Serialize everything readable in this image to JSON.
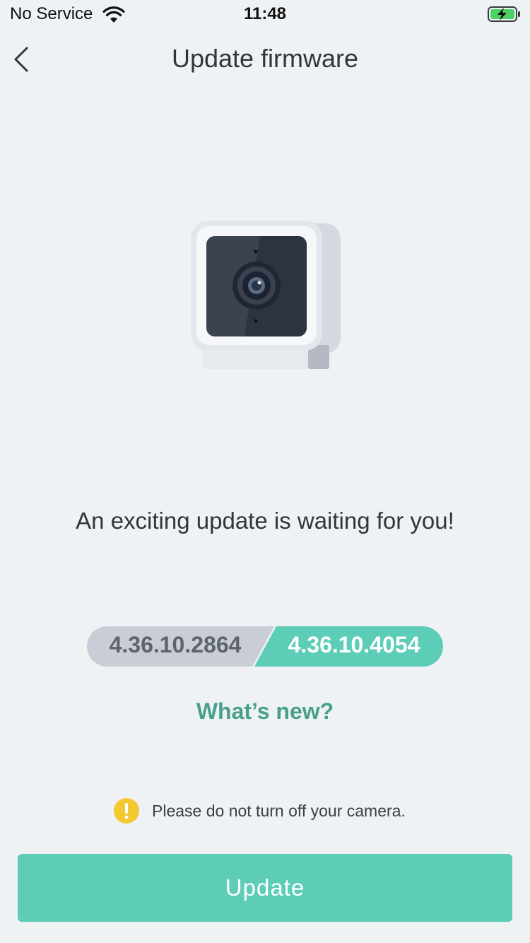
{
  "status_bar": {
    "carrier": "No Service",
    "time": "11:48",
    "wifi_icon": "wifi-icon",
    "battery_icon": "battery-charging-icon"
  },
  "header": {
    "back_icon": "chevron-left-icon",
    "title": "Update firmware"
  },
  "hero": {
    "image": "camera-illustration"
  },
  "message": {
    "headline": "An exciting update is waiting for you!"
  },
  "versions": {
    "current": "4.36.10.2864",
    "new": "4.36.10.4054"
  },
  "whats_new_link": "What’s new?",
  "warning": {
    "icon": "warning-icon",
    "text": "Please do not turn off your camera."
  },
  "primary_button": {
    "label": "Update"
  },
  "colors": {
    "background": "#eff2f5",
    "accent": "#5ecdb8",
    "link": "#48a08c",
    "old_version_pill": "#c9ced6",
    "new_version_pill": "#5ecdb8",
    "warning": "#f4c830"
  }
}
